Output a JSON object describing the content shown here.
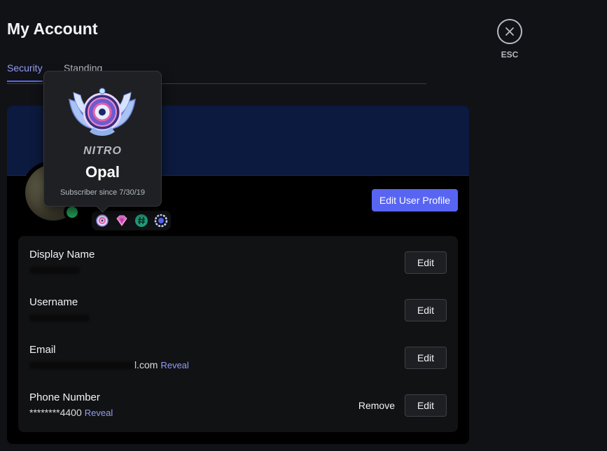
{
  "header": {
    "title": "My Account"
  },
  "tabs": [
    {
      "label": "Security",
      "active": true
    },
    {
      "label": "Standing",
      "active": false
    }
  ],
  "close": {
    "label": "ESC",
    "icon": "close-icon"
  },
  "profile": {
    "edit_profile_label": "Edit User Profile",
    "status": "online",
    "badges": [
      "nitro-opal-badge",
      "boost-gem-badge",
      "hashtag-badge",
      "quest-laurel-badge"
    ]
  },
  "tooltip": {
    "brand": "NITRO",
    "tier": "Opal",
    "since": "Subscriber since 7/30/19"
  },
  "fields": {
    "display_name": {
      "label": "Display Name",
      "edit_label": "Edit"
    },
    "username": {
      "label": "Username",
      "edit_label": "Edit"
    },
    "email": {
      "label": "Email",
      "value_suffix": "l.com",
      "reveal_label": "Reveal",
      "edit_label": "Edit"
    },
    "phone": {
      "label": "Phone Number",
      "value": "********4400",
      "reveal_label": "Reveal",
      "remove_label": "Remove",
      "edit_label": "Edit"
    }
  },
  "colors": {
    "accent": "#5865f2",
    "link": "#949cf7",
    "online": "#23a55a",
    "banner": "#0c1a3f"
  }
}
